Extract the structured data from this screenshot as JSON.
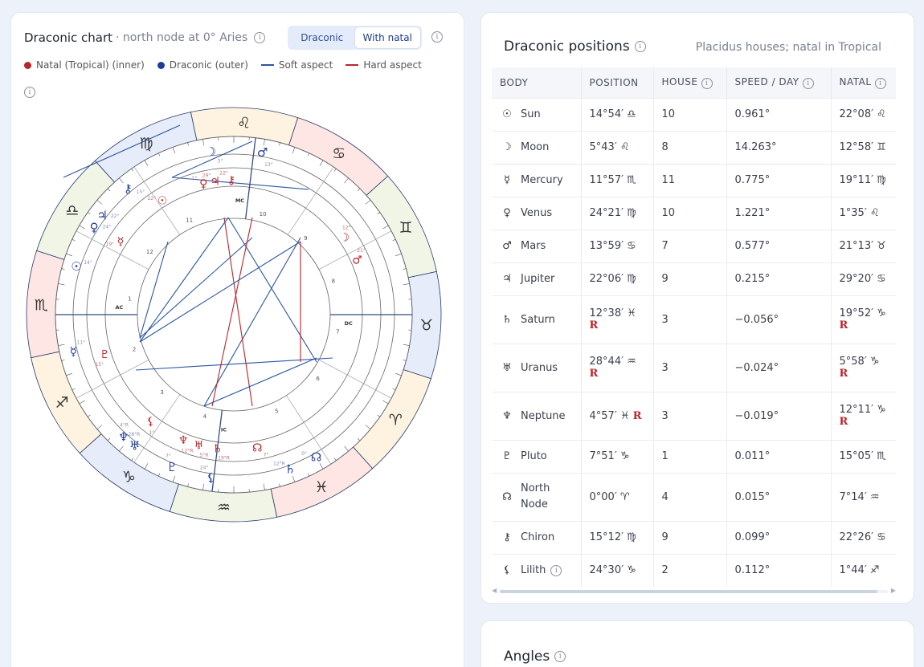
{
  "chart": {
    "title": "Draconic chart",
    "subtitle": "· north node at 0° Aries",
    "toggle": [
      "Draconic",
      "With natal"
    ],
    "legend": {
      "natal": "Natal (Tropical) (inner)",
      "draconic": "Draconic (outer)",
      "soft": "Soft aspect",
      "hard": "Hard aspect"
    },
    "colors": {
      "natal": "#b8262a",
      "draconic": "#1d3c9a",
      "soft": "#2b55a0",
      "hard": "#b8262a"
    },
    "zodiac_glyphs": [
      "♌",
      "♋",
      "♊",
      "♉",
      "♈",
      "♓",
      "♒",
      "♑",
      "♐",
      "♏",
      "♎",
      "♍"
    ],
    "house_numbers": [
      "10",
      "9",
      "8",
      "7",
      "6",
      "5",
      "4",
      "3",
      "2",
      "1",
      "12",
      "11"
    ],
    "angle_labels": {
      "ac": "AC",
      "dc": "DC",
      "mc": "MC",
      "ic": "IC"
    },
    "outer_planets": [
      {
        "g": "☽",
        "deg": "5°"
      },
      {
        "g": "♂",
        "deg": "13°"
      },
      {
        "g": "♀",
        "deg": "24°"
      },
      {
        "g": "♃",
        "deg": "22°"
      },
      {
        "g": "⚷",
        "deg": "15°"
      },
      {
        "g": "☉",
        "deg": "14°"
      },
      {
        "g": "☿",
        "deg": "11°"
      },
      {
        "g": "♇",
        "deg": "7°"
      },
      {
        "g": "⚸",
        "deg": "24°"
      },
      {
        "g": "♅",
        "deg": "28°R"
      },
      {
        "g": "♆",
        "deg": "4°R"
      },
      {
        "g": "♄",
        "deg": "12°R"
      },
      {
        "g": "☊",
        "deg": "0°"
      }
    ],
    "inner_planets": [
      {
        "g": "☉",
        "deg": "22°"
      },
      {
        "g": "♀",
        "deg": "1°"
      },
      {
        "g": "♃",
        "deg": "29°"
      },
      {
        "g": "⚷",
        "deg": "22°"
      },
      {
        "g": "☽",
        "deg": "12°"
      },
      {
        "g": "♂",
        "deg": "21°"
      },
      {
        "g": "☿",
        "deg": "19°"
      },
      {
        "g": "♇",
        "deg": "15°"
      },
      {
        "g": "⚸",
        "deg": "1°"
      },
      {
        "g": "♅",
        "deg": "5°R"
      },
      {
        "g": "♆",
        "deg": "12°R"
      },
      {
        "g": "♄",
        "deg": "19°R"
      },
      {
        "g": "☊",
        "deg": "7°"
      }
    ]
  },
  "positions": {
    "title": "Draconic positions",
    "note": "Placidus houses; natal in Tropical",
    "headers": [
      "BODY",
      "POSITION",
      "HOUSE",
      "SPEED / DAY",
      "NATAL"
    ],
    "rows": [
      {
        "icon": "☉",
        "body": "Sun",
        "position": "14°54′ ♎",
        "position_r": "",
        "house": "10",
        "speed": "0.961°",
        "natal": "22°08′ ♌",
        "natal_r": ""
      },
      {
        "icon": "☽",
        "body": "Moon",
        "position": "5°43′ ♌",
        "position_r": "",
        "house": "8",
        "speed": "14.263°",
        "natal": "12°58′ ♊",
        "natal_r": ""
      },
      {
        "icon": "☿",
        "body": "Mercury",
        "position": "11°57′ ♏",
        "position_r": "",
        "house": "11",
        "speed": "0.775°",
        "natal": "19°11′ ♍",
        "natal_r": ""
      },
      {
        "icon": "♀",
        "body": "Venus",
        "position": "24°21′ ♍",
        "position_r": "",
        "house": "10",
        "speed": "1.221°",
        "natal": "1°35′ ♌",
        "natal_r": ""
      },
      {
        "icon": "♂",
        "body": "Mars",
        "position": "13°59′ ♋",
        "position_r": "",
        "house": "7",
        "speed": "0.577°",
        "natal": "21°13′ ♉",
        "natal_r": ""
      },
      {
        "icon": "♃",
        "body": "Jupiter",
        "position": "22°06′ ♍",
        "position_r": "",
        "house": "9",
        "speed": "0.215°",
        "natal": "29°20′ ♋",
        "natal_r": ""
      },
      {
        "icon": "♄",
        "body": "Saturn",
        "position": "12°38′ ♓",
        "position_r": "R",
        "house": "3",
        "speed": "−0.056°",
        "natal": "19°52′ ♑",
        "natal_r": "R"
      },
      {
        "icon": "♅",
        "body": "Uranus",
        "position": "28°44′ ♒",
        "position_r": "R",
        "house": "3",
        "speed": "−0.024°",
        "natal": "5°58′ ♑",
        "natal_r": "R"
      },
      {
        "icon": "♆",
        "body": "Neptune",
        "position": "4°57′ ♓",
        "position_r": "R",
        "house": "3",
        "speed": "−0.019°",
        "natal": "12°11′ ♑",
        "natal_r": "R"
      },
      {
        "icon": "♇",
        "body": "Pluto",
        "position": "7°51′ ♑",
        "position_r": "",
        "house": "1",
        "speed": "0.011°",
        "natal": "15°05′ ♏",
        "natal_r": ""
      },
      {
        "icon": "☊",
        "body": "North Node",
        "position": "0°00′ ♈",
        "position_r": "",
        "house": "4",
        "speed": "0.015°",
        "natal": "7°14′ ♒",
        "natal_r": ""
      },
      {
        "icon": "⚷",
        "body": "Chiron",
        "position": "15°12′ ♍",
        "position_r": "",
        "house": "9",
        "speed": "0.099°",
        "natal": "22°26′ ♋",
        "natal_r": ""
      },
      {
        "icon": "⚸",
        "body": "Lilith",
        "position": "24°30′ ♑",
        "position_r": "",
        "house": "2",
        "speed": "0.112°",
        "natal": "1°44′ ♐",
        "natal_r": ""
      }
    ]
  },
  "angles": {
    "title": "Angles"
  }
}
